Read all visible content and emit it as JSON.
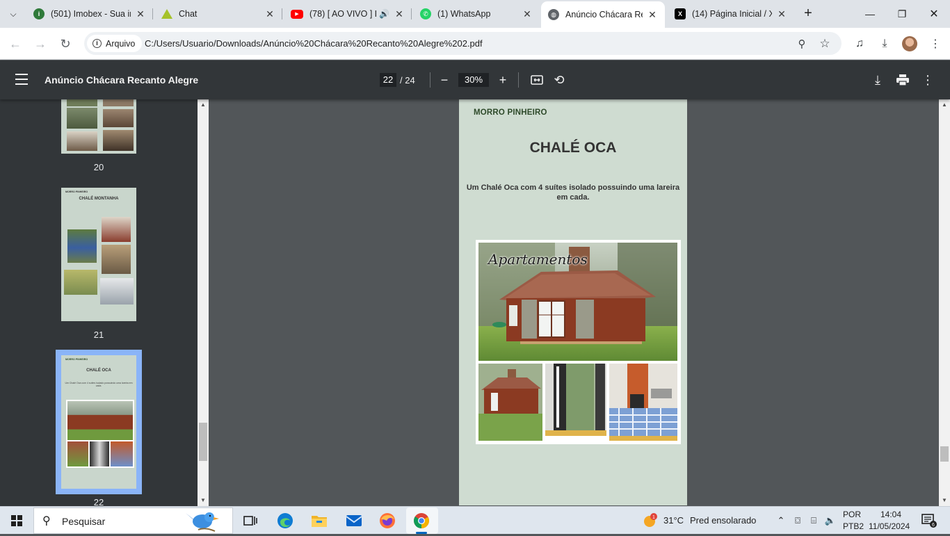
{
  "browser": {
    "tabs": [
      {
        "title": "(501) Imobex - Sua im",
        "favicon": "imobex-icon"
      },
      {
        "title": "Chat",
        "favicon": "chat-icon"
      },
      {
        "title": "(78) [ AO VIVO ] L",
        "favicon": "youtube-icon"
      },
      {
        "title": "(1) WhatsApp",
        "favicon": "whatsapp-icon"
      },
      {
        "title": "Anúncio Chácara Rec",
        "favicon": "globe-icon",
        "active": true
      },
      {
        "title": "(14) Página Inicial / X",
        "favicon": "x-icon"
      }
    ],
    "address": {
      "chip_label": "Arquivo",
      "url": "C:/Users/Usuario/Downloads/Anúncio%20Chácara%20Recanto%20Alegre%202.pdf"
    }
  },
  "pdf": {
    "title": "Anúncio Chácara Recanto Alegre",
    "current_page": "22",
    "total_pages": "/ 24",
    "zoom": "30%"
  },
  "thumbnails": [
    {
      "label": "20"
    },
    {
      "label": "21",
      "region": "MORRO PINHEIRO",
      "title": "CHALÉ MONTANHA"
    },
    {
      "label": "22",
      "region": "MORRO PINHEIRO",
      "title": "CHALÉ OCA",
      "selected": true
    }
  ],
  "page": {
    "region": "MORRO PINHEIRO",
    "heading": "CHALÉ OCA",
    "description": "Um Chalé Oca  com  4 suítes isolado possuindo uma lareira em cada.",
    "photo_caption": "Apartamentos"
  },
  "taskbar": {
    "search_placeholder": "Pesquisar",
    "weather_temp": "31°C",
    "weather_desc": "Pred ensolarado",
    "weather_badge": "1",
    "lang": "POR",
    "layout": "PTB2",
    "time": "14:04",
    "date": "11/05/2024",
    "notifications": "6"
  }
}
